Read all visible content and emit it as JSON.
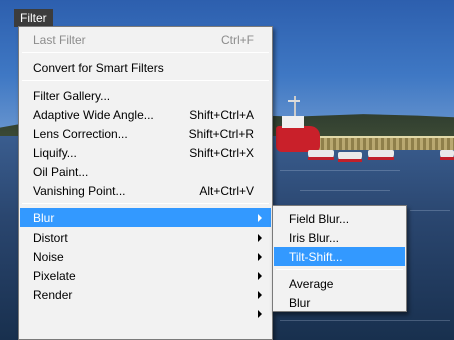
{
  "menubar": {
    "filter_label": "Filter"
  },
  "filter_menu": {
    "last_filter": {
      "label": "Last Filter",
      "shortcut": "Ctrl+F"
    },
    "convert_smart": {
      "label": "Convert for Smart Filters"
    },
    "filter_gallery": {
      "label": "Filter Gallery..."
    },
    "adaptive_wide_angle": {
      "label": "Adaptive Wide Angle...",
      "shortcut": "Shift+Ctrl+A"
    },
    "lens_correction": {
      "label": "Lens Correction...",
      "shortcut": "Shift+Ctrl+R"
    },
    "liquify": {
      "label": "Liquify...",
      "shortcut": "Shift+Ctrl+X"
    },
    "oil_paint": {
      "label": "Oil Paint..."
    },
    "vanishing_point": {
      "label": "Vanishing Point...",
      "shortcut": "Alt+Ctrl+V"
    },
    "blur": {
      "label": "Blur"
    },
    "distort": {
      "label": "Distort"
    },
    "noise": {
      "label": "Noise"
    },
    "pixelate": {
      "label": "Pixelate"
    },
    "render": {
      "label": "Render"
    }
  },
  "blur_submenu": {
    "field_blur": {
      "label": "Field Blur..."
    },
    "iris_blur": {
      "label": "Iris Blur..."
    },
    "tilt_shift": {
      "label": "Tilt-Shift..."
    },
    "average": {
      "label": "Average"
    },
    "blur": {
      "label": "Blur"
    }
  },
  "colors": {
    "highlight": "#3399ff",
    "menu_bg": "#f2f2f2",
    "disabled_text": "#8c8c8c"
  }
}
